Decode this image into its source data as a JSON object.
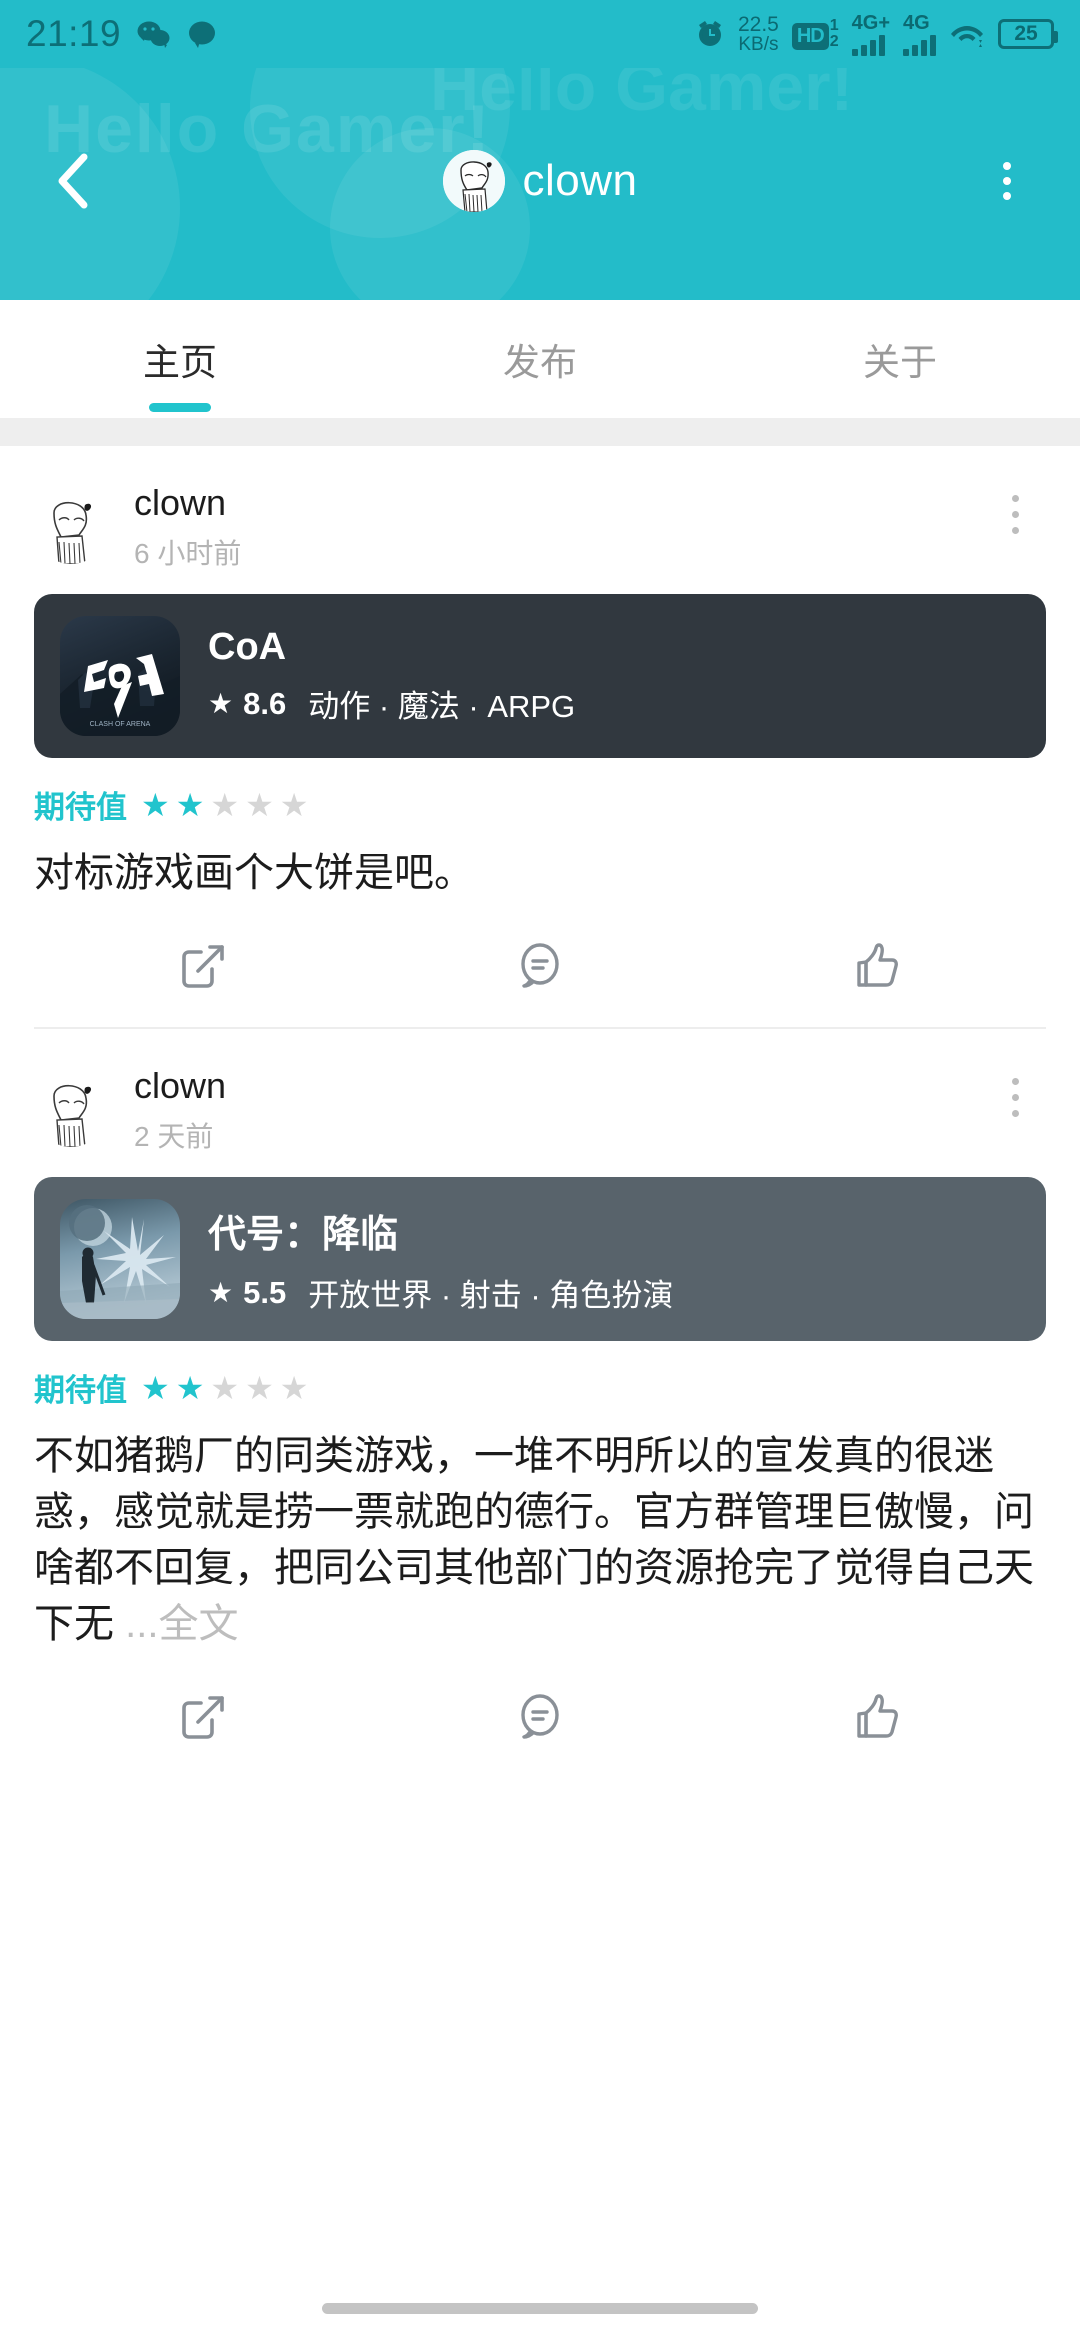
{
  "statusbar": {
    "time": "21:19",
    "icons": [
      "wechat-icon",
      "message-icon",
      "alarm-icon"
    ],
    "netspeed_value": "22.5",
    "netspeed_unit": "KB/s",
    "hd_label": "HD",
    "hd_sup": "1",
    "hd_sub": "2",
    "sim1_label": "4G+",
    "sim2_label": "4G",
    "wifi": "wifi-icon",
    "battery_level": "25"
  },
  "header": {
    "watermark": "Hello Gamer!",
    "back_icon": "back-chevron-icon",
    "title": "clown",
    "avatar": "user-avatar",
    "menu_icon": "overflow-menu-icon",
    "accent": "#23bcc9"
  },
  "tabs": [
    {
      "label": "主页",
      "active": true
    },
    {
      "label": "发布",
      "active": false
    },
    {
      "label": "关于",
      "active": false
    }
  ],
  "posts": [
    {
      "author": "clown",
      "time": "6 小时前",
      "more_icon": "post-overflow-icon",
      "game": {
        "name": "CoA",
        "score": "8.6",
        "star": "★",
        "tags": "动作 · 魔法 · ARPG",
        "card_bg": "#31383f",
        "icon_name": "coa-game-icon"
      },
      "expect_label": "期待值",
      "expect_filled": 2,
      "expect_total": 5,
      "text": "对标游戏画个大饼是吧。",
      "truncated": false,
      "more_label": "",
      "actions": [
        "share-icon",
        "comment-icon",
        "like-icon"
      ]
    },
    {
      "author": "clown",
      "time": "2 天前",
      "more_icon": "post-overflow-icon",
      "game": {
        "name": "代号：降临",
        "score": "5.5",
        "star": "★",
        "tags": "开放世界 · 射击 · 角色扮演",
        "card_bg": "#58636b",
        "icon_name": "jianglin-game-icon"
      },
      "expect_label": "期待值",
      "expect_filled": 2,
      "expect_total": 5,
      "text": "不如猪鹅厂的同类游戏，一堆不明所以的宣发真的很迷惑，感觉就是捞一票就跑的德行。官方群管理巨傲慢，问啥都不回复，把同公司其他部门的资源抢完了觉得自己天下无 ",
      "truncated": true,
      "more_label": "全文",
      "ellipsis": "...",
      "actions": [
        "share-icon",
        "comment-icon",
        "like-icon"
      ]
    }
  ],
  "colors": {
    "accent": "#21c4cd",
    "status_bg": "#23bcc9",
    "muted": "#b4b4b4"
  }
}
